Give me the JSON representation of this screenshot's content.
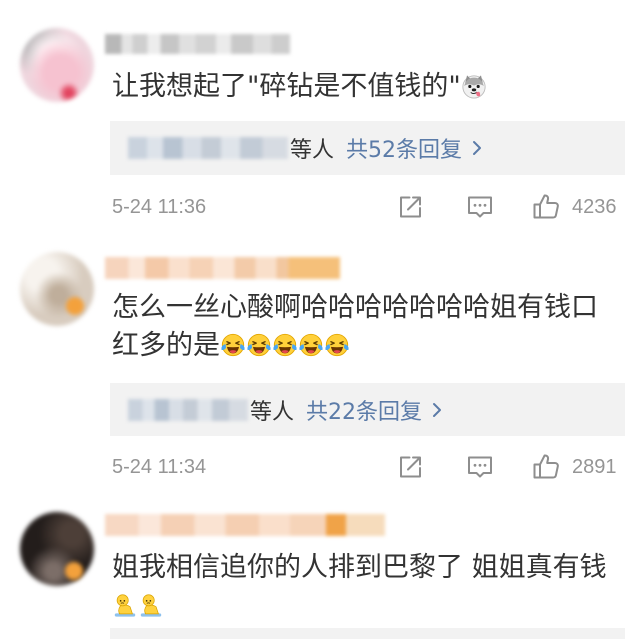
{
  "colors": {
    "comment_text": "#333333",
    "reply_link": "#5b7ba8",
    "meta_text": "#959595",
    "icon": "#8e8e8e",
    "reply_background": "#f2f2f2",
    "background": "#ffffff"
  },
  "icons": {
    "repost": "repost-icon",
    "comment": "comment-icon",
    "like": "like-icon",
    "chevron": "chevron-right-icon"
  },
  "comments": [
    {
      "text_lines": [
        "让我想起了\"碎钻是不值钱的\""
      ],
      "emojis": [
        "doge-emoji-icon"
      ],
      "reply": {
        "suffix": "等人",
        "count_label": "共52条回复"
      },
      "time": "5-24 11:36",
      "likes": "4236"
    },
    {
      "text_lines": [
        "怎么一丝心酸啊哈哈哈哈哈哈哈姐有钱口",
        "红多的是"
      ],
      "emojis": [
        "laugh-cry-emoji-icon",
        "laugh-cry-emoji-icon",
        "laugh-cry-emoji-icon",
        "laugh-cry-emoji-icon",
        "laugh-cry-emoji-icon"
      ],
      "reply": {
        "suffix": "等人",
        "count_label": "共22条回复"
      },
      "time": "5-24 11:34",
      "likes": "2891"
    },
    {
      "text_lines": [
        "姐我相信追你的人排到巴黎了 姐姐真有钱"
      ],
      "emojis": [
        "kneel-emoji-icon",
        "kneel-emoji-icon"
      ]
    }
  ]
}
